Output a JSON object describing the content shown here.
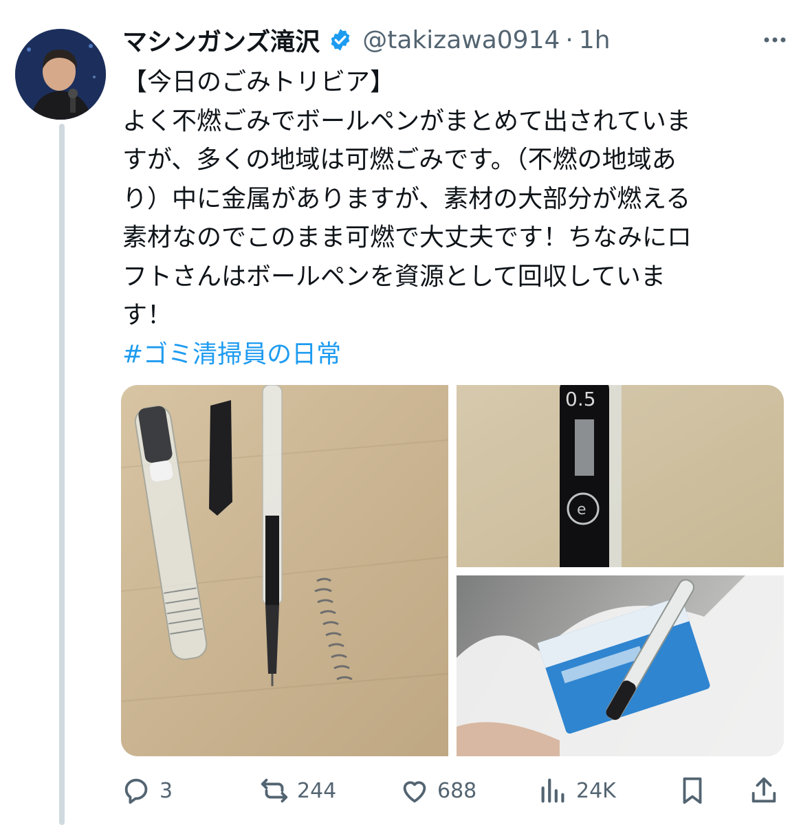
{
  "tweet": {
    "author_name": "マシンガンズ滝沢",
    "handle": "@takizawa0914",
    "separator": "·",
    "time": "1h",
    "lines": [
      "【今日のごみトリビア】",
      "よく不燃ごみでボールペンがまとめて出されていま",
      "すが、多くの地域は可燃ごみです。（不燃の地域あ",
      "り）中に金属がありますが、素材の大部分が燃える",
      "素材なのでこのまま可燃で大丈夫です！ちなみにロ",
      "フトさんはボールペンを資源として回収していま",
      "す！"
    ],
    "hashtag": "#ゴミ清掃員の日常"
  },
  "media": {
    "image2_text": "0.5"
  },
  "actions": {
    "replies": "3",
    "reposts": "244",
    "likes": "688",
    "views": "24K"
  },
  "colors": {
    "accent": "#1d9bf0",
    "secondary_text": "#536471",
    "primary_text": "#0f1419"
  },
  "icons": [
    "more-icon",
    "verified-icon",
    "reply-icon",
    "repost-icon",
    "like-icon",
    "views-icon",
    "bookmark-icon",
    "share-icon"
  ]
}
